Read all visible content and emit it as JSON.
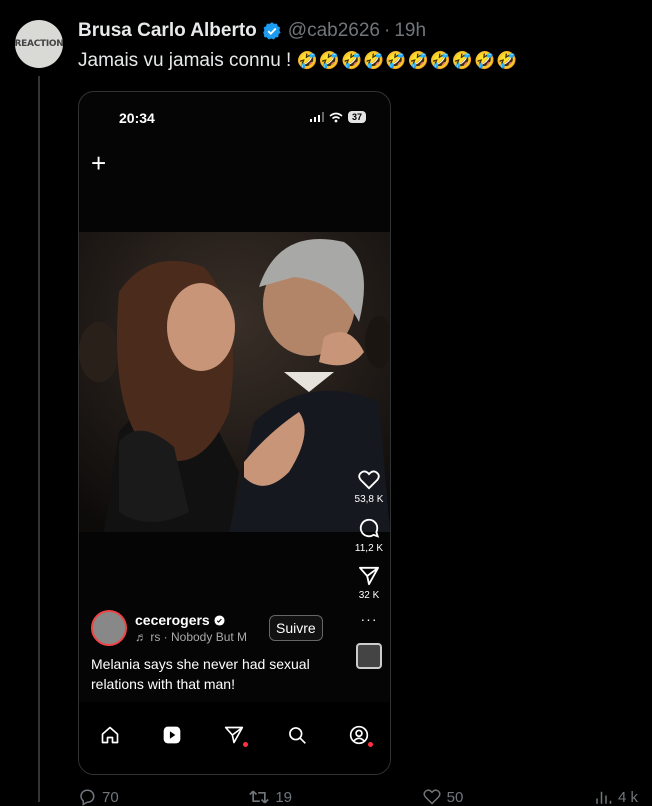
{
  "tweet": {
    "avatar_text": "REACTION",
    "author_name": "Brusa Carlo Alberto",
    "handle": "@cab2626",
    "separator": "·",
    "time": "19h",
    "text": "Jamais vu jamais connu !",
    "emojis": "🤣🤣🤣🤣🤣🤣🤣🤣🤣🤣"
  },
  "phone": {
    "status_time": "20:34",
    "battery": "37",
    "actions": {
      "likes": "53,8 K",
      "comments": "11,2 K",
      "shares": "32 K",
      "more": "···"
    },
    "username": "cecerogers",
    "music": "♬ rs · Nobody But M",
    "follow_label": "Suivre",
    "caption": "Melania says she never had sexual relations with that man!"
  },
  "footer": {
    "replies": "70",
    "reposts": "19",
    "likes": "50",
    "views": "4 k"
  },
  "colors": {
    "background": "#000000",
    "text_primary": "#e7e9ea",
    "text_secondary": "#71767b",
    "verified_blue": "#1d9bf0",
    "notification_red": "#ff3040"
  }
}
